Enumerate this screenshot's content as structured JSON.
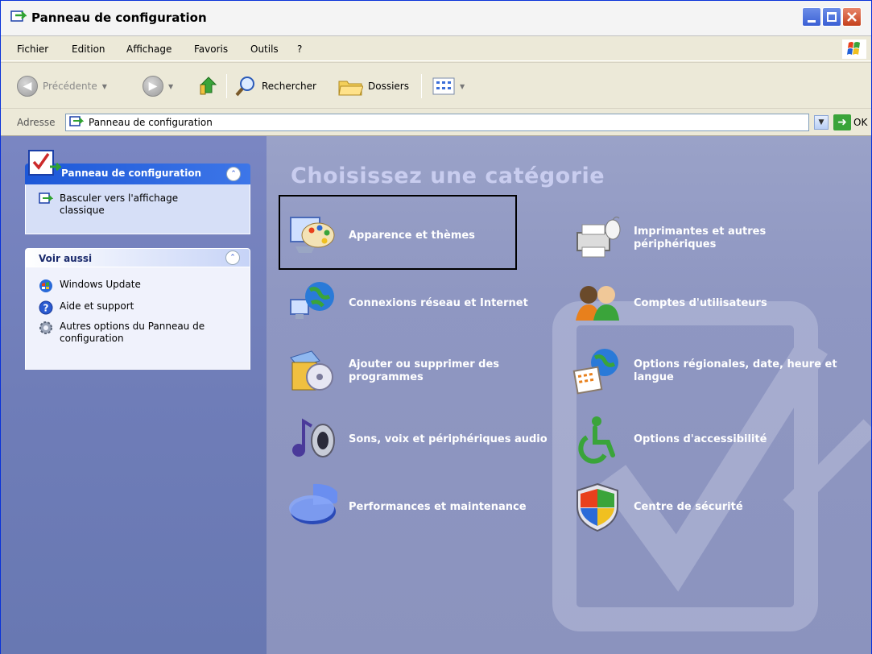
{
  "window": {
    "title": "Panneau de configuration",
    "title_icon": "control-panel-icon"
  },
  "menu": {
    "items": [
      "Fichier",
      "Edition",
      "Affichage",
      "Favoris",
      "Outils",
      "?"
    ]
  },
  "toolbar": {
    "back_label": "Précédente",
    "search_label": "Rechercher",
    "folders_label": "Dossiers"
  },
  "address": {
    "label": "Adresse",
    "value": "Panneau de configuration",
    "go_label": "OK"
  },
  "sidebar": {
    "panel_title": "Panneau de configuration",
    "switch_view": "Basculer vers l'affichage classique",
    "see_also_title": "Voir aussi",
    "see_also_items": [
      {
        "label": "Windows Update",
        "icon": "windows-update-icon"
      },
      {
        "label": "Aide et support",
        "icon": "help-icon"
      },
      {
        "label": "Autres options du Panneau de configuration",
        "icon": "gear-icon"
      }
    ]
  },
  "main": {
    "heading": "Choisissez une catégorie",
    "categories": [
      {
        "label": "Apparence et thèmes",
        "icon": "appearance-themes-icon"
      },
      {
        "label": "Imprimantes et autres périphériques",
        "icon": "printer-icon"
      },
      {
        "label": "Connexions réseau et Internet",
        "icon": "network-globe-icon"
      },
      {
        "label": "Comptes d'utilisateurs",
        "icon": "user-accounts-icon"
      },
      {
        "label": "Ajouter ou supprimer des programmes",
        "icon": "add-remove-programs-icon"
      },
      {
        "label": "Options régionales, date, heure et langue",
        "icon": "regional-options-icon"
      },
      {
        "label": "Sons, voix et périphériques audio",
        "icon": "sound-speaker-icon"
      },
      {
        "label": "Options d'accessibilité",
        "icon": "accessibility-icon"
      },
      {
        "label": "Performances et maintenance",
        "icon": "performance-pie-icon"
      },
      {
        "label": "Centre de sécurité",
        "icon": "security-shield-icon"
      }
    ]
  },
  "colors": {
    "title_accent": "#1d58d8",
    "panel_bg": "#6f7db8",
    "content_bg": "#8f97c2",
    "heading_color": "#c9cdef"
  }
}
